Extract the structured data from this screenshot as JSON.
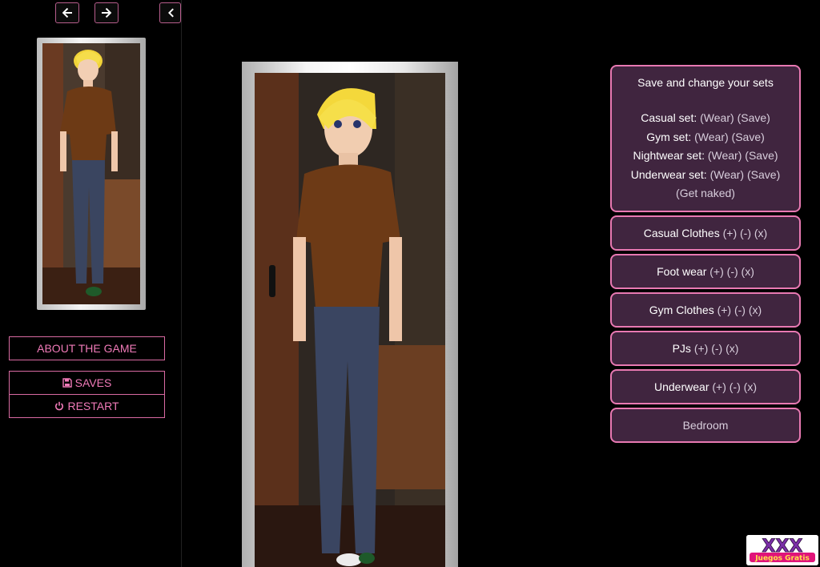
{
  "nav": {
    "back_icon": "arrow-left-icon",
    "forward_icon": "arrow-right-icon",
    "collapse_icon": "chevron-left-icon"
  },
  "sidebar": {
    "about_label": "ABOUT THE GAME",
    "saves_label": "SAVES",
    "saves_icon": "floppy-disk-icon",
    "restart_label": "RESTART",
    "restart_icon": "power-icon"
  },
  "sets_panel": {
    "title": "Save and change your sets",
    "sets": [
      {
        "name": "Casual set:",
        "wear": "(Wear)",
        "save": "(Save)"
      },
      {
        "name": "Gym set:",
        "wear": "(Wear)",
        "save": "(Save)"
      },
      {
        "name": "Nightwear set:",
        "wear": "(Wear)",
        "save": "(Save)"
      },
      {
        "name": "Underwear set:",
        "wear": "(Wear)",
        "save": "(Save)"
      }
    ],
    "naked": "(Get naked)"
  },
  "clothes": [
    {
      "label": "Casual Clothes",
      "add": "(+)",
      "remove": "(-)",
      "clear": "(x)"
    },
    {
      "label": "Foot wear",
      "add": "(+)",
      "remove": "(-)",
      "clear": "(x)"
    },
    {
      "label": "Gym Clothes",
      "add": "(+)",
      "remove": "(-)",
      "clear": "(x)"
    },
    {
      "label": "PJs",
      "add": "(+)",
      "remove": "(-)",
      "clear": "(x)"
    },
    {
      "label": "Underwear",
      "add": "(+)",
      "remove": "(-)",
      "clear": "(x)"
    }
  ],
  "location": "Bedroom",
  "watermark": {
    "line1": "XXX",
    "line2": "Juegos Gratis"
  },
  "colors": {
    "accent": "#e879b2",
    "panel_bg": "#40253f",
    "sidebar_link": "#f07ab8"
  }
}
